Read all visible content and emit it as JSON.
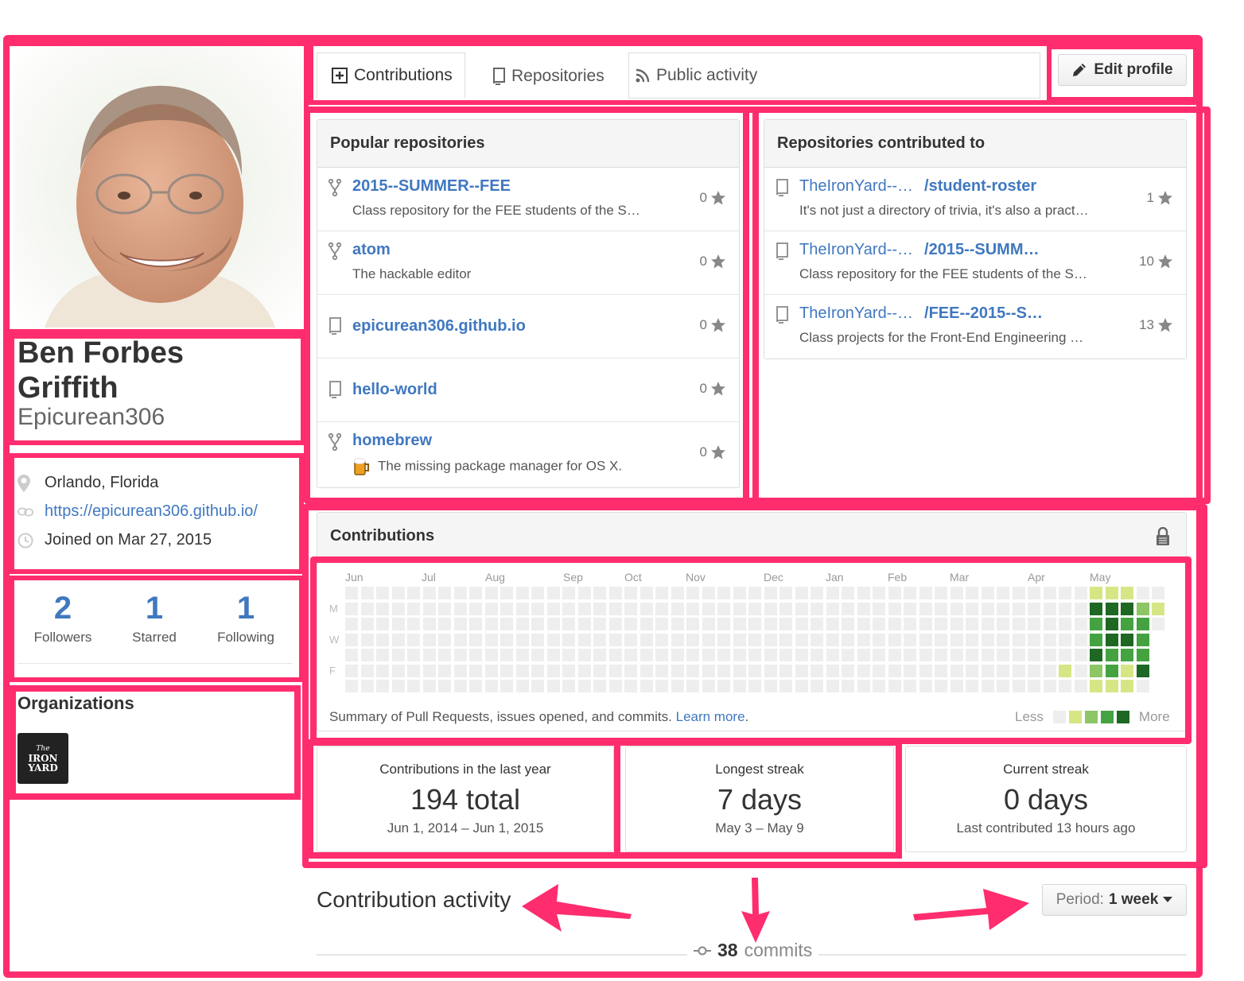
{
  "tabs": {
    "contributions": "Contributions",
    "repositories": "Repositories",
    "public_activity": "Public activity",
    "edit_profile": "Edit profile"
  },
  "profile": {
    "name": "Ben Forbes Griffith",
    "username": "Epicurean306",
    "location": "Orlando, Florida",
    "website": "https://epicurean306.github.io/",
    "joined": "Joined on Mar 27, 2015"
  },
  "stats": [
    {
      "value": "2",
      "label": "Followers"
    },
    {
      "value": "1",
      "label": "Starred"
    },
    {
      "value": "1",
      "label": "Following"
    }
  ],
  "organizations": {
    "title": "Organizations",
    "logo_text_1": "The",
    "logo_text_2": "IRON",
    "logo_text_3": "YARD"
  },
  "popular_repos": {
    "title": "Popular repositories",
    "items": [
      {
        "icon": "fork-icon",
        "name": "2015--SUMMER--FEE",
        "desc": "Class repository for the FEE students of the S…",
        "stars": "0"
      },
      {
        "icon": "fork-icon",
        "name": "atom",
        "desc": "The hackable editor",
        "stars": "0"
      },
      {
        "icon": "repo-icon",
        "name": "epicurean306.github.io",
        "desc": "",
        "stars": "0"
      },
      {
        "icon": "repo-icon",
        "name": "hello-world",
        "desc": "",
        "stars": "0"
      },
      {
        "icon": "fork-icon",
        "name": "homebrew",
        "desc": "The missing package manager for OS X.",
        "stars": "0"
      }
    ]
  },
  "contributed_repos": {
    "title": "Repositories contributed to",
    "items": [
      {
        "owner": "TheIronYard--…",
        "name": "/student-roster",
        "desc": "It's not just a directory of trivia, it's also a pract…",
        "stars": "1"
      },
      {
        "owner": "TheIronYard--…",
        "name": "/2015--SUMM…",
        "desc": "Class repository for the FEE students of the S…",
        "stars": "10"
      },
      {
        "owner": "TheIronYard--…",
        "name": "/FEE--2015--S…",
        "desc": "Class projects for the Front-End Engineering …",
        "stars": "13"
      }
    ]
  },
  "contributions": {
    "title": "Contributions",
    "months": [
      "Jun",
      "Jul",
      "Aug",
      "Sep",
      "Oct",
      "Nov",
      "Dec",
      "Jan",
      "Feb",
      "Mar",
      "Apr",
      "May"
    ],
    "days": [
      "M",
      "W",
      "F"
    ],
    "summary_text": "Summary of Pull Requests, issues opened, and commits.",
    "learn_more": "Learn more",
    "legend_less": "Less",
    "legend_more": "More",
    "colors": [
      "#eeeeee",
      "#d6e685",
      "#8cc665",
      "#44a340",
      "#1e6823"
    ],
    "last_weeks_levels": [
      [
        0,
        0,
        0,
        0,
        0,
        1,
        0
      ],
      [
        0,
        0,
        0,
        0,
        0,
        0,
        0
      ],
      [
        1,
        4,
        3,
        3,
        4,
        2,
        1
      ],
      [
        1,
        4,
        4,
        4,
        3,
        3,
        1
      ],
      [
        1,
        4,
        3,
        4,
        3,
        1,
        1
      ],
      [
        0,
        2,
        3,
        3,
        3,
        4,
        0
      ],
      [
        0,
        1,
        0,
        0,
        0,
        0,
        0
      ]
    ]
  },
  "summary": [
    {
      "title": "Contributions in the last year",
      "value": "194 total",
      "sub": "Jun 1, 2014 – Jun 1, 2015"
    },
    {
      "title": "Longest streak",
      "value": "7 days",
      "sub": "May 3 – May 9"
    },
    {
      "title": "Current streak",
      "value": "0 days",
      "sub": "Last contributed 13 hours ago"
    }
  ],
  "activity": {
    "title": "Contribution activity",
    "period_label": "Period:",
    "period_value": "1 week",
    "commits_count": "38",
    "commits_label": "commits"
  },
  "annotation_color": "#ff2d6e"
}
